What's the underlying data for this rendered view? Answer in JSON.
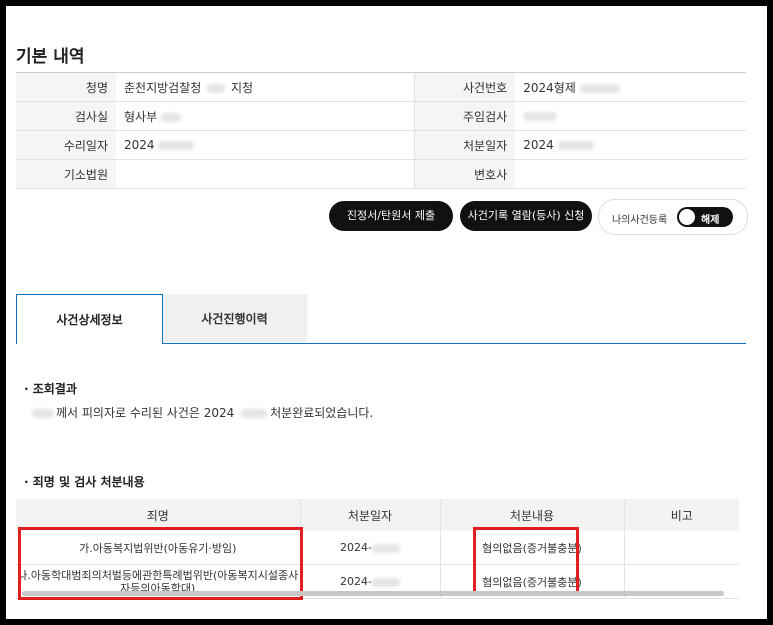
{
  "section_title": "기본 내역",
  "basic": {
    "row1": {
      "l1": "청명",
      "v1": "춘천지방검찰청",
      "v1_suffix": "지청",
      "l2": "사건번호",
      "v2": "2024형제"
    },
    "row2": {
      "l1": "검사실",
      "v1": "형사부",
      "l2": "주임검사",
      "v2": ""
    },
    "row3": {
      "l1": "수리일자",
      "v1": "2024",
      "l2": "처분일자",
      "v2": "2024"
    },
    "row4": {
      "l1": "기소법원",
      "v1": "",
      "l2": "변호사",
      "v2": ""
    }
  },
  "buttons": {
    "petition": "진정서/탄원서 제출",
    "record_view": "사건기록 열람(등사) 신청",
    "my_case_label": "나의사건등록",
    "toggle_label": "해제"
  },
  "tabs": {
    "detail": "사건상세정보",
    "history": "사건진행이력"
  },
  "inquiry": {
    "heading": "· 조회결과",
    "text_a": "께서 피의자로 수리된 사건은 2024",
    "text_b": "처분완료되었습니다."
  },
  "crime": {
    "heading": "· 죄명 및 검사 처분내용",
    "headers": [
      "죄명",
      "처분일자",
      "처분내용",
      "비고"
    ],
    "rows": [
      {
        "name": "가.아동복지법위반(아동유기·방임)",
        "date": "2024-",
        "result": "혐의없음(증거불충분)",
        "note": ""
      },
      {
        "name": "나.아동학대범죄의처벌등에관한특례법위반(아동복지시설종사자등의아동학대)",
        "date": "2024-",
        "result": "혐의없음(증거불충분)",
        "note": ""
      }
    ]
  },
  "colors": {
    "accent_blue": "#0a74c2",
    "highlight_red": "#e02020",
    "button_dark": "#111111"
  }
}
